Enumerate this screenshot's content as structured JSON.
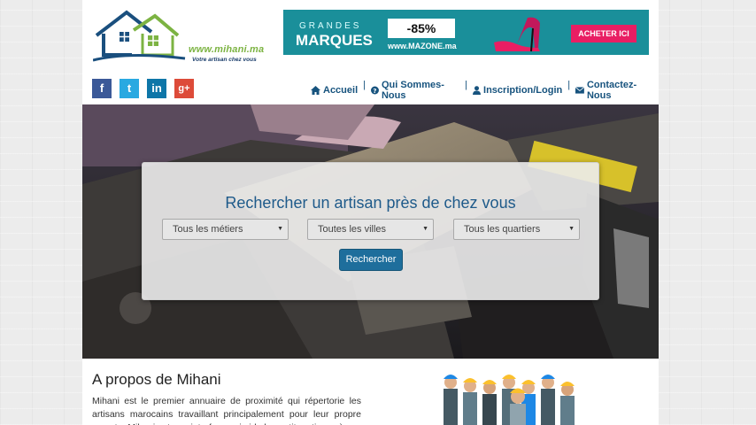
{
  "header": {
    "logo_url": "www.mihani.ma",
    "logo_tagline": "Votre artisan chez vous"
  },
  "ad": {
    "grandes": "GRANDES",
    "marques": "MARQUES",
    "discount": "-85%",
    "site": "www.MAZONE.ma",
    "cta": "ACHETER ICI",
    "colors": {
      "background": "#1a8f9a",
      "button": "#e91e63"
    }
  },
  "social": [
    {
      "name": "facebook",
      "glyph": "f"
    },
    {
      "name": "twitter",
      "glyph": "t"
    },
    {
      "name": "linkedin",
      "glyph": "in"
    },
    {
      "name": "google-plus",
      "glyph": "g+"
    }
  ],
  "nav": {
    "home": "Accueil",
    "about": "Qui Sommes-Nous",
    "signup": "Inscription/Login",
    "contact": "Contactez-Nous",
    "separator": "|"
  },
  "search": {
    "title": "Rechercher un artisan près de chez vous",
    "trade_select": "Tous les métiers",
    "city_select": "Toutes les villes",
    "district_select": "Tous les quartiers",
    "button": "Rechercher"
  },
  "about": {
    "title": "A propos de Mihani",
    "text": "Mihani est le premier annuaire de proximité qui répertorie les artisans marocains travaillant principalement pour leur propre compte. Mihani est une interface qui aide les petits artisans à"
  }
}
